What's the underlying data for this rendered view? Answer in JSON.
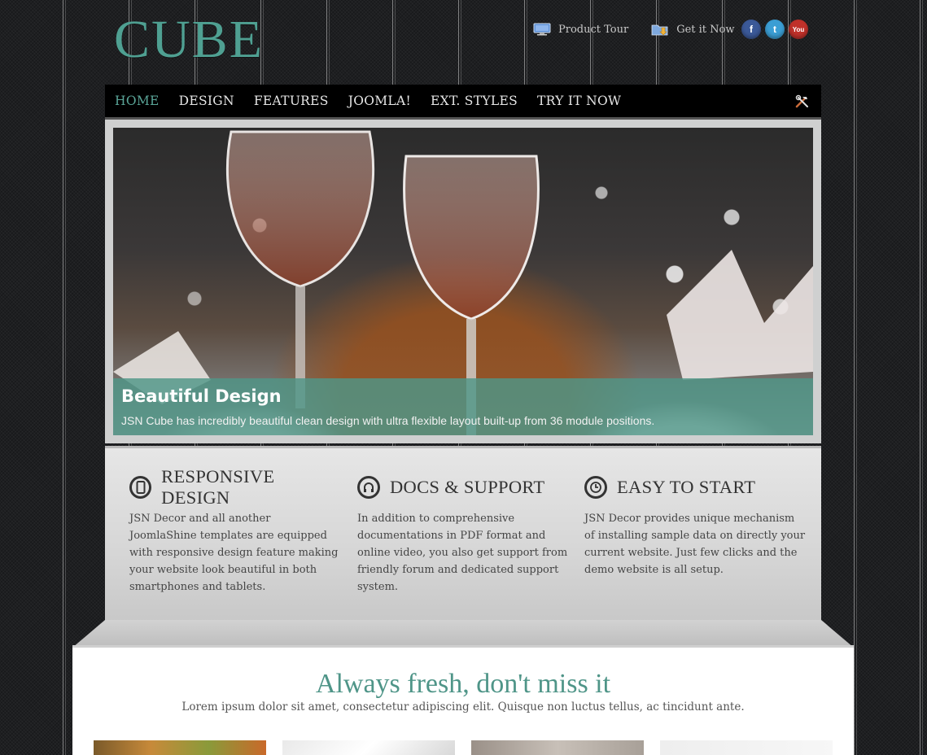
{
  "header": {
    "logo": "CUBE",
    "links": [
      {
        "label": "Product Tour",
        "icon": "monitor-icon"
      },
      {
        "label": "Get it Now",
        "icon": "folder-download-icon"
      }
    ],
    "social": [
      {
        "name": "facebook-icon",
        "glyph": "f",
        "color": "#3b5998"
      },
      {
        "name": "twitter-icon",
        "glyph": "t",
        "color": "#3b9ed4"
      },
      {
        "name": "youtube-icon",
        "glyph": "You",
        "color": "#c0312a"
      }
    ]
  },
  "nav": {
    "items": [
      "HOME",
      "DESIGN",
      "FEATURES",
      "JOOMLA!",
      "EXT. STYLES",
      "TRY IT NOW"
    ],
    "active": 0,
    "tools_icon": "tools-icon"
  },
  "slider": {
    "caption_title": "Beautiful Design",
    "caption_text": "JSN Cube has incredibly beautiful clean design with ultra flexible layout built-up from 36 module positions."
  },
  "features": [
    {
      "icon": "phone-icon",
      "title": "RESPONSIVE DESIGN",
      "text": "JSN Decor and all another JoomlaShine templates are equipped with responsive design feature making your website look beautiful in both smartphones and tablets."
    },
    {
      "icon": "headphones-icon",
      "title": "DOCS & SUPPORT",
      "text": "In addition to comprehensive documentations in PDF format and online video, you also get support from friendly forum and dedicated support system."
    },
    {
      "icon": "clock-icon",
      "title": "EASY TO START",
      "text": "JSN Decor provides unique mechanism of installing sample data on directly your current website. Just few clicks and the demo website is all setup."
    }
  ],
  "content": {
    "heading": "Always fresh, don't miss it",
    "subheading": "Lorem ipsum dolor sit amet, consectetur adipiscing elit. Quisque non luctus tellus, ac tincidunt ante."
  },
  "colors": {
    "accent": "#4f9588",
    "nav_bg": "#000000",
    "caption_bg": "#4f9687"
  }
}
